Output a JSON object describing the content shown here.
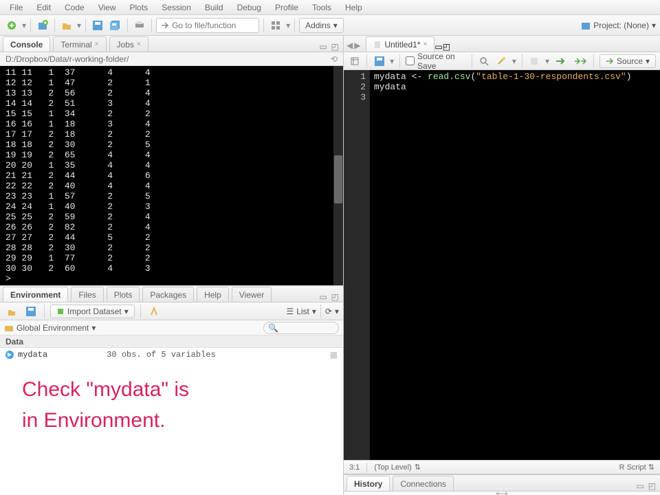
{
  "menu": [
    "File",
    "Edit",
    "Code",
    "View",
    "Plots",
    "Session",
    "Build",
    "Debug",
    "Profile",
    "Tools",
    "Help"
  ],
  "toolbar": {
    "goto": "Go to file/function",
    "addins": "Addins",
    "project": "Project: (None)"
  },
  "left": {
    "tabs": [
      "Console",
      "Terminal",
      "Jobs"
    ],
    "console_path": "D:/Dropbox/Data/r-working-folder/",
    "console_rows": [
      "11 11   1  37      4      4",
      "12 12   1  47      2      1",
      "13 13   2  56      2      4",
      "14 14   2  51      3      4",
      "15 15   1  34      2      2",
      "16 16   1  18      3      4",
      "17 17   2  18      2      2",
      "18 18   2  30      2      5",
      "19 19   2  65      4      4",
      "20 20   1  35      4      4",
      "21 21   2  44      4      6",
      "22 22   2  40      4      4",
      "23 23   1  57      2      5",
      "24 24   1  40      2      3",
      "25 25   2  59      2      4",
      "26 26   2  82      2      4",
      "27 27   2  44      5      2",
      "28 28   2  30      2      2",
      "29 29   1  77      2      2",
      "30 30   2  60      4      3",
      ">"
    ],
    "env_tabs": [
      "Environment",
      "Files",
      "Plots",
      "Packages",
      "Help",
      "Viewer"
    ],
    "env_tool": {
      "import": "Import Dataset",
      "list": "List"
    },
    "env_scope": "Global Environment",
    "env_section": "Data",
    "env_item": {
      "name": "mydata",
      "detail": "30 obs. of 5 variables"
    },
    "annotation_l1": "Check \"mydata\" is",
    "annotation_l2": "in Environment."
  },
  "source": {
    "filename": "Untitled1*",
    "source_on_save": "Source on Save",
    "source_btn": "Source",
    "lines": [
      "1",
      "2",
      "3"
    ],
    "code1_a": "mydata",
    "code1_b": " <- ",
    "code1_fn": "read.csv",
    "code1_c": "(",
    "code1_str": "\"table-1-30-respondents.csv\"",
    "code1_d": ")",
    "code2": "mydata",
    "status_pos": "3:1",
    "status_scope": "(Top Level)",
    "status_type": "R Script"
  },
  "history_tabs": [
    "History",
    "Connections"
  ]
}
